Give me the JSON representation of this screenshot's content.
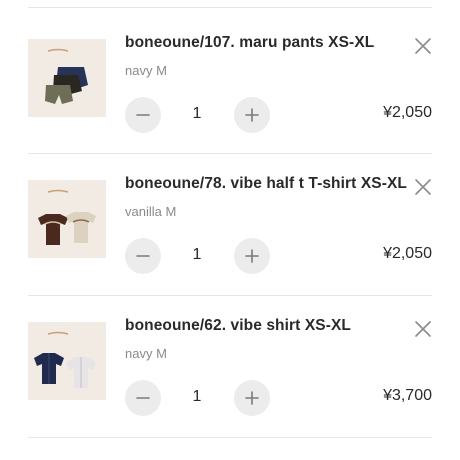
{
  "cart": {
    "items": [
      {
        "title": "boneoune/107. maru pants XS-XL",
        "variant": "navy M",
        "quantity": "1",
        "price": "¥2,050",
        "image_icon": "maru-pants-product-image"
      },
      {
        "title": "boneoune/78. vibe half t T-shirt XS-XL",
        "variant": "vanilla M",
        "quantity": "1",
        "price": "¥2,050",
        "image_icon": "vibe-tshirt-product-image"
      },
      {
        "title": "boneoune/62. vibe shirt XS-XL",
        "variant": "navy M",
        "quantity": "1",
        "price": "¥3,700",
        "image_icon": "vibe-shirt-product-image"
      }
    ]
  },
  "colors": {
    "divider": "#e6e6e6",
    "stepper_bg": "#ececec",
    "text_primary": "#2a2a2a",
    "text_secondary": "#8a8a8a",
    "thumb_bg": "#f1ebe4"
  }
}
